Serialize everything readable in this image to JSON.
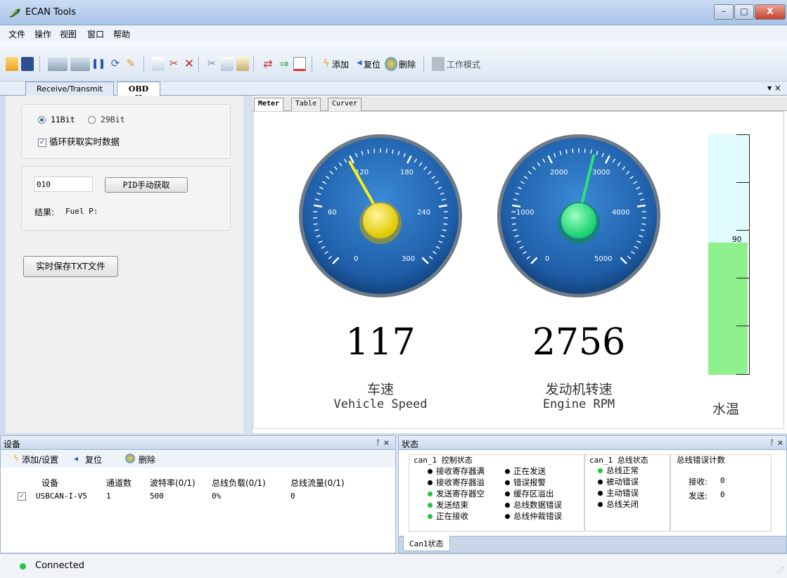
{
  "window": {
    "title": "ECAN Tools",
    "min": "–",
    "max": "□",
    "close": "X"
  },
  "menu": [
    "文件",
    "操作",
    "视图",
    "窗口",
    "帮助"
  ],
  "toolbar": {
    "add": "添加",
    "reset": "复位",
    "delete": "删除",
    "work_mode": "工作模式"
  },
  "doc_tabs": [
    "Receive/Transmit",
    "OBD II"
  ],
  "doc_tab_ctrl": "▾ ×",
  "left": {
    "radio_11": "11Bit",
    "radio_29": "29Bit",
    "loop_label": "循环获取实时数据",
    "pid_value": "010",
    "pid_button": "PID手动获取",
    "result_label": "结果:",
    "result_value": "Fuel P:",
    "save_button": "实时保存TXT文件"
  },
  "meter_tabs": [
    "Meter",
    "Table",
    "Curver"
  ],
  "gauges": {
    "speed": {
      "ticks": [
        "0",
        "60",
        "120",
        "180",
        "240",
        "300"
      ],
      "value": "117",
      "label_cn": "车速",
      "label_en": "Vehicle Speed",
      "needle_value": 117,
      "min": 0,
      "max": 300
    },
    "rpm": {
      "ticks": [
        "0",
        "1000",
        "2000",
        "3000",
        "4000",
        "5000"
      ],
      "value": "2756",
      "label_cn": "发动机转速",
      "label_en": "Engine RPM",
      "needle_value": 2756,
      "min": 0,
      "max": 5000
    }
  },
  "water": {
    "label": "水温",
    "value_label": "90",
    "level": 90,
    "max": 150
  },
  "device_panel": {
    "title": "设备",
    "pin": "ᚨ ×",
    "add": "添加/设置",
    "reset": "复位",
    "delete": "删除",
    "columns": [
      "设备",
      "通道数",
      "波特率(0/1)",
      "总线负载(0/1)",
      "总线流量(0/1)"
    ],
    "rows": [
      {
        "check": "✓",
        "name": "USBCAN-I-V5",
        "channels": "1",
        "baud": "500",
        "load": "0%",
        "flow": "0"
      }
    ]
  },
  "status_panel": {
    "title": "状态",
    "pin": "ᚨ ×",
    "ctrl_title": "can_1 控制状态",
    "ctrl_col1": [
      "接收寄存器满",
      "接收寄存器溢",
      "发送寄存器空",
      "发送结束",
      "正在接收"
    ],
    "ctrl_col1_green": [
      false,
      false,
      true,
      true,
      true
    ],
    "ctrl_col2": [
      "正在发送",
      "错误报警",
      "缓存区溢出",
      "总线数据错误",
      "总线仲裁错误"
    ],
    "bus_title": "can_1 总线状态",
    "bus": [
      "总线正常",
      "被动错误",
      "主动错误",
      "总线关闭"
    ],
    "bus_green": [
      true,
      false,
      false,
      false
    ],
    "err_title": "总线错误计数",
    "recv_label": "接收:",
    "recv_value": "0",
    "send_label": "发送:",
    "send_value": "0",
    "tab": "Can1状态"
  },
  "statusbar": {
    "text": "Connected"
  }
}
